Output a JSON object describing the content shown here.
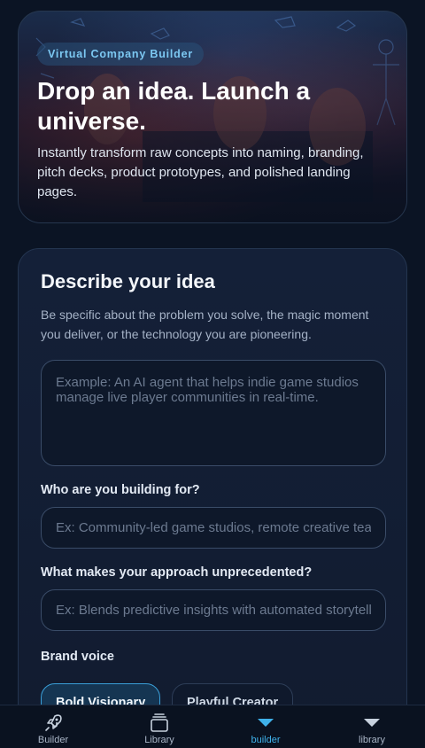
{
  "hero": {
    "badge": "Virtual Company Builder",
    "title": "Drop an idea. Launch a universe.",
    "description": "Instantly transform raw concepts into naming, branding, pitch decks, product prototypes, and polished landing pages."
  },
  "form": {
    "title": "Describe your idea",
    "subtitle": "Be specific about the problem you solve, the magic moment you deliver, or the technology you are pioneering.",
    "idea_placeholder": "Example: An AI agent that helps indie game studios manage live player communities in real-time.",
    "audience_label": "Who are you building for?",
    "audience_placeholder": "Ex: Community-led game studios, remote creative teams",
    "approach_label": "What makes your approach unprecedented?",
    "approach_placeholder": "Ex: Blends predictive insights with automated storytelling",
    "voice_label": "Brand voice",
    "voice_options": [
      "Bold Visionary",
      "Playful Creator"
    ]
  },
  "nav": {
    "items": [
      {
        "label": "Builder",
        "icon": "rocket-icon"
      },
      {
        "label": "Library",
        "icon": "stack-icon"
      },
      {
        "label": "builder",
        "icon": "triangle-down-icon"
      },
      {
        "label": "library",
        "icon": "triangle-down-icon"
      }
    ],
    "active_index": 2
  },
  "colors": {
    "accent": "#3fb1ea",
    "background": "#0b1424"
  }
}
